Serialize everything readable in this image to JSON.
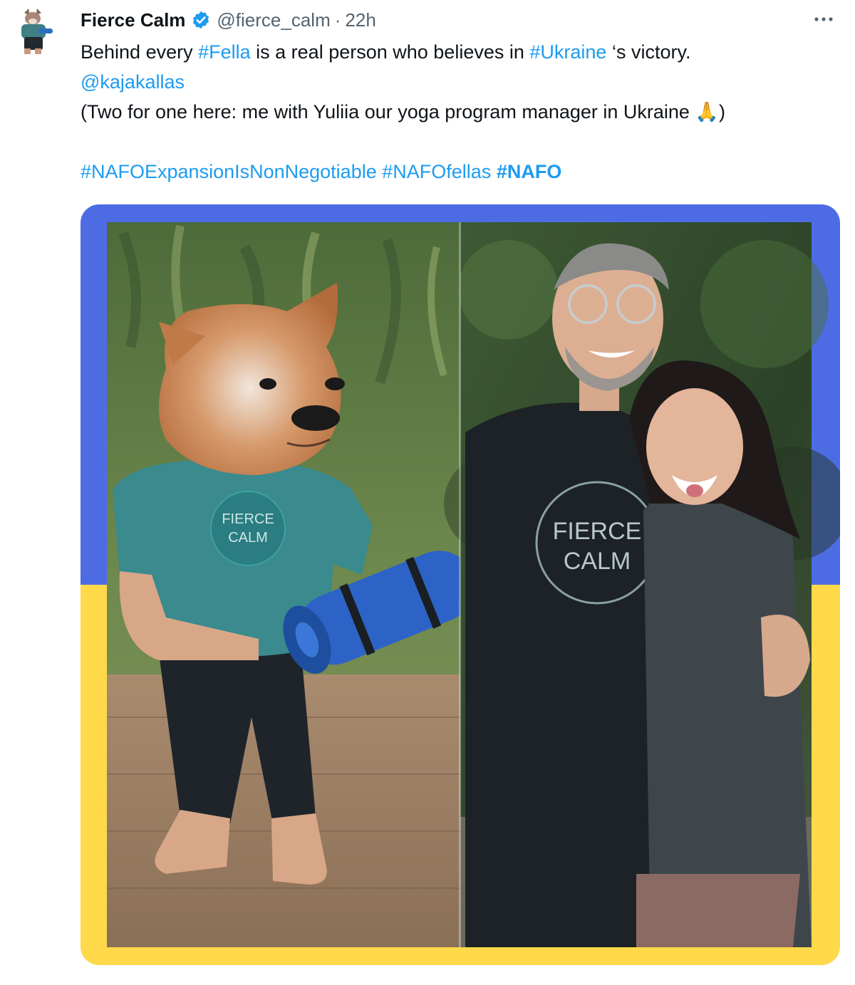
{
  "tweet": {
    "author": {
      "display_name": "Fierce Calm",
      "handle": "@fierce_calm",
      "verified": true,
      "avatar_icon": "fella-avatar-icon"
    },
    "separator": "·",
    "timestamp": "22h",
    "more_icon": "more-horizontal-icon",
    "text": {
      "line1": {
        "t1": "Behind every ",
        "hashtag_fella": "#Fella",
        "t2": " is a real person who believes in ",
        "hashtag_ukraine": "#Ukraine",
        "t3": " ‘s victory."
      },
      "mention": "@kajakallas",
      "line3": "(Two for one here: me with Yuliia our yoga program manager in Ukraine 🙏)",
      "hashtags": {
        "h1": "#NAFOExpansionIsNonNegotiable",
        "h2": "#NAFOfellas",
        "h3": "#NAFO"
      }
    },
    "media": {
      "frame_colors": {
        "top": "#4d6ce4",
        "bottom": "#ffd94a"
      },
      "left_photo": {
        "shirt_logo_line1": "FIERCE",
        "shirt_logo_line2": "CALM"
      },
      "right_photo": {
        "shirt_logo_line1": "FIERCE",
        "shirt_logo_line2": "CALM"
      }
    },
    "colors": {
      "link": "#1d9bf0",
      "text": "#0f1419",
      "secondary": "#536471",
      "verified": "#1d9bf0"
    }
  }
}
